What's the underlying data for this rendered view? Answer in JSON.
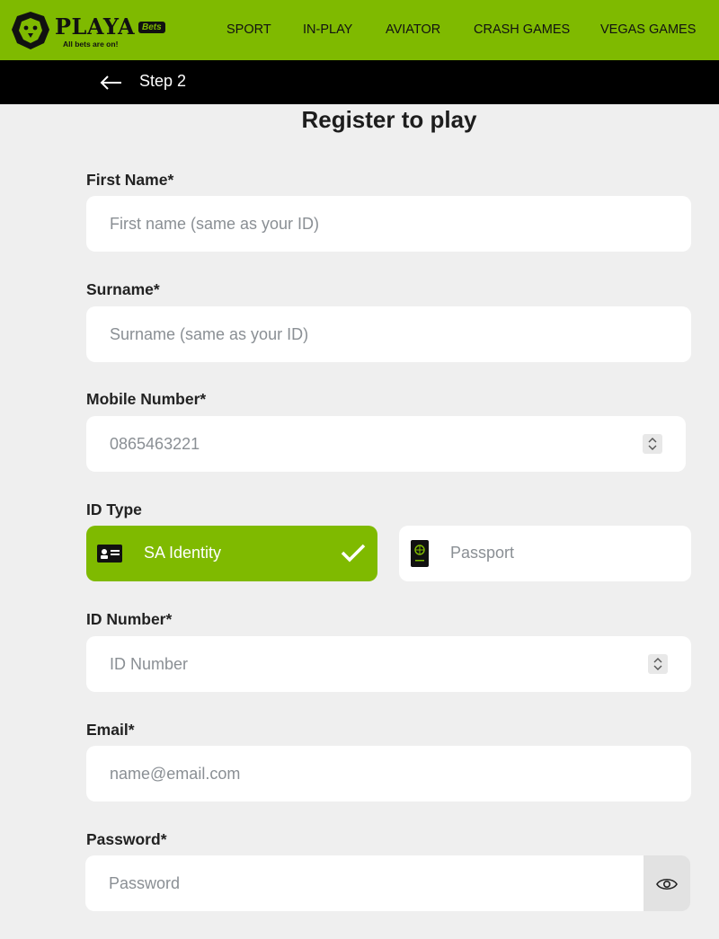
{
  "header": {
    "brand": "PLAYA",
    "brand_badge": "Bets",
    "tagline": "All bets are on!",
    "nav": [
      "SPORT",
      "IN-PLAY",
      "AVIATOR",
      "CRASH GAMES",
      "VEGAS GAMES"
    ]
  },
  "stepbar": {
    "label": "Step 2",
    "back_icon": "arrow-left-icon"
  },
  "form": {
    "title": "Register to play",
    "first_name": {
      "label": "First Name",
      "required_mark": "*",
      "placeholder": "First name (same as your ID)",
      "value": ""
    },
    "surname": {
      "label": "Surname",
      "required_mark": "*",
      "placeholder": "Surname (same as your ID)",
      "value": ""
    },
    "mobile": {
      "label": "Mobile Number",
      "required_mark": "*",
      "placeholder": "0865463221",
      "value": ""
    },
    "id_type": {
      "label": "ID Type",
      "options": [
        {
          "label": "SA Identity",
          "icon": "id-card-icon",
          "selected": true
        },
        {
          "label": "Passport",
          "icon": "passport-icon",
          "selected": false
        }
      ]
    },
    "id_number": {
      "label": "ID Number",
      "required_mark": "*",
      "placeholder": "ID Number",
      "value": ""
    },
    "email": {
      "label": "Email",
      "required_mark": "*",
      "placeholder": "name@email.com",
      "value": ""
    },
    "password": {
      "label": "Password",
      "required_mark": "*",
      "placeholder": "Password",
      "value": ""
    }
  },
  "colors": {
    "brand_green": "#7fba00",
    "background": "#efefef",
    "step_bar": "#000000"
  }
}
